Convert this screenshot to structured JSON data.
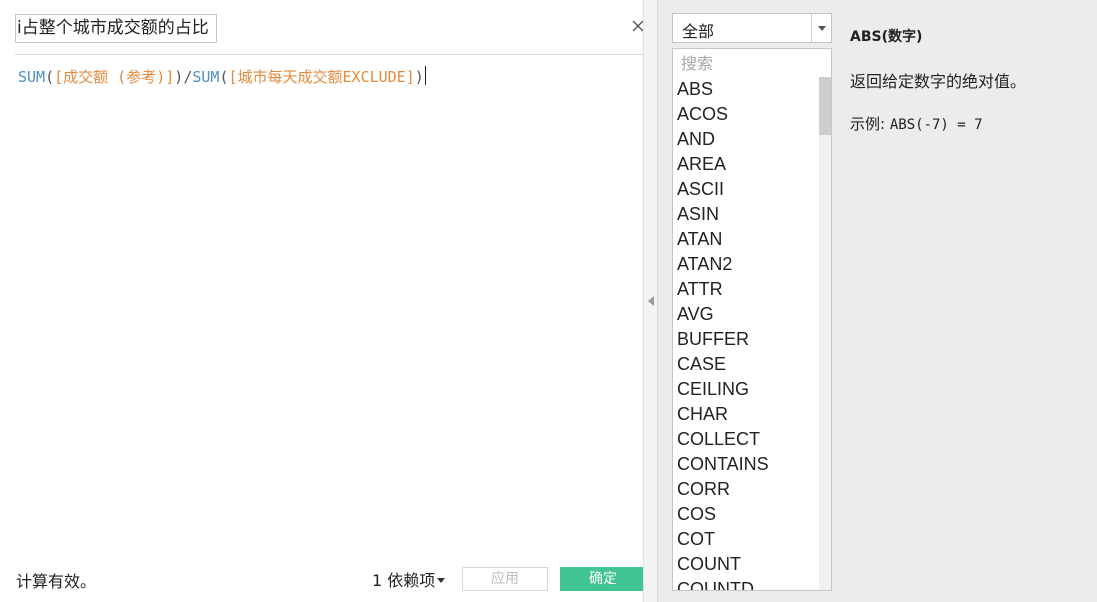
{
  "editor": {
    "name_value": "i占整个城市成交额的占比",
    "formula": [
      {
        "text": "SUM",
        "type": "fn"
      },
      {
        "text": "(",
        "type": "op"
      },
      {
        "text": "[成交额 (参考)]",
        "type": "fld"
      },
      {
        "text": ")",
        "type": "op"
      },
      {
        "text": "/",
        "type": "op"
      },
      {
        "text": "SUM",
        "type": "fn"
      },
      {
        "text": "(",
        "type": "op"
      },
      {
        "text": "[城市每天成交额EXCLUDE]",
        "type": "fld"
      },
      {
        "text": ")",
        "type": "op"
      }
    ],
    "status": "计算有效。",
    "dependencies": "1 依赖项",
    "apply_label": "应用",
    "ok_label": "确定"
  },
  "functions": {
    "category": "全部",
    "search_placeholder": "搜索",
    "items": [
      "ABS",
      "ACOS",
      "AND",
      "AREA",
      "ASCII",
      "ASIN",
      "ATAN",
      "ATAN2",
      "ATTR",
      "AVG",
      "BUFFER",
      "CASE",
      "CEILING",
      "CHAR",
      "COLLECT",
      "CONTAINS",
      "CORR",
      "COS",
      "COT",
      "COUNT",
      "COUNTD"
    ],
    "selected": {
      "title": "ABS(数字)",
      "description": "返回给定数字的绝对值。",
      "example_label": "示例:",
      "example_code": "ABS(-7) = 7"
    }
  },
  "colors": {
    "function_token": "#4f8fc2",
    "field_token": "#e6893a",
    "ok_button": "#3fc492"
  },
  "icons": {
    "close": "close-icon",
    "dropdown": "chevron-down-icon",
    "splitter": "collapse-left-icon"
  }
}
